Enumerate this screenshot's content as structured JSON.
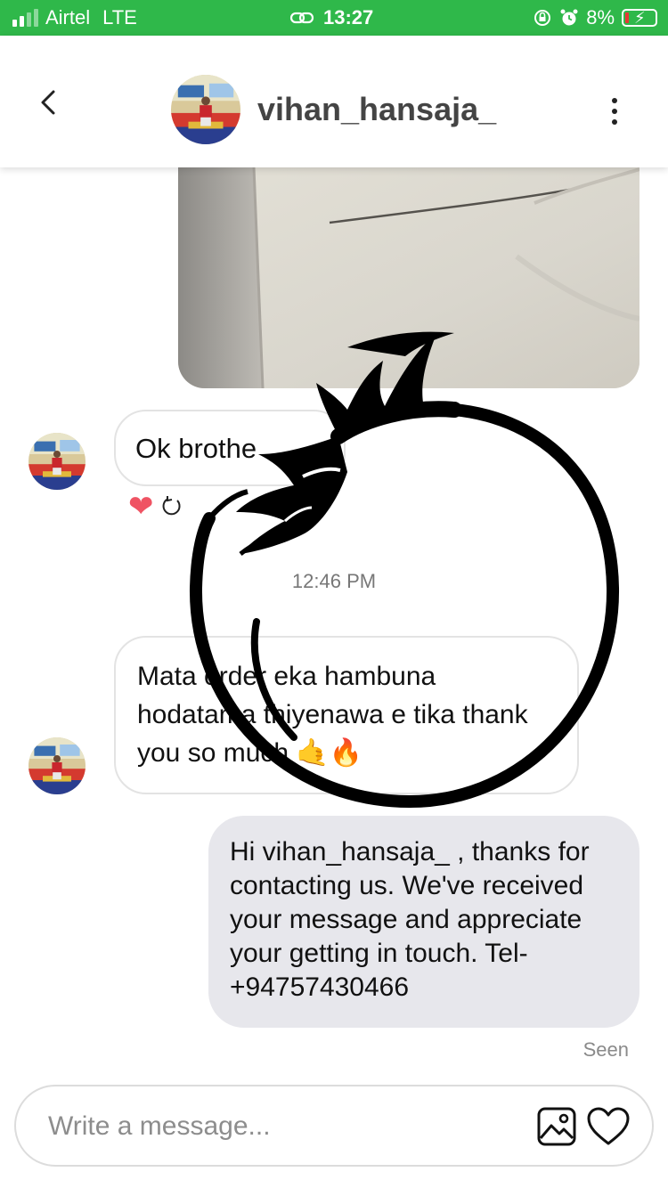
{
  "status_bar": {
    "carrier": "Airtel",
    "network": "LTE",
    "time": "13:27",
    "battery_percent": "8%",
    "bg_color": "#2fb84a"
  },
  "header": {
    "username": "vihan_hansaja_"
  },
  "conversation": {
    "messages": [
      {
        "direction": "incoming",
        "text": "Ok brothe"
      },
      {
        "direction": "incoming",
        "text": "Mata order eka hambuna hodatama thiyenawa e tika thank you so much 🤙🔥"
      },
      {
        "direction": "outgoing",
        "text": "Hi vihan_hansaja_ , thanks for contacting us. We've received your message and appreciate your getting in touch. Tel-+94757430466"
      }
    ],
    "timestamp_separator": "12:46 PM",
    "seen_label": "Seen",
    "reaction": "❤"
  },
  "composer": {
    "placeholder": "Write a message..."
  },
  "icons": {
    "back": "chevron-left-icon",
    "more": "more-vertical-icon",
    "image": "image-icon",
    "like": "heart-icon"
  }
}
